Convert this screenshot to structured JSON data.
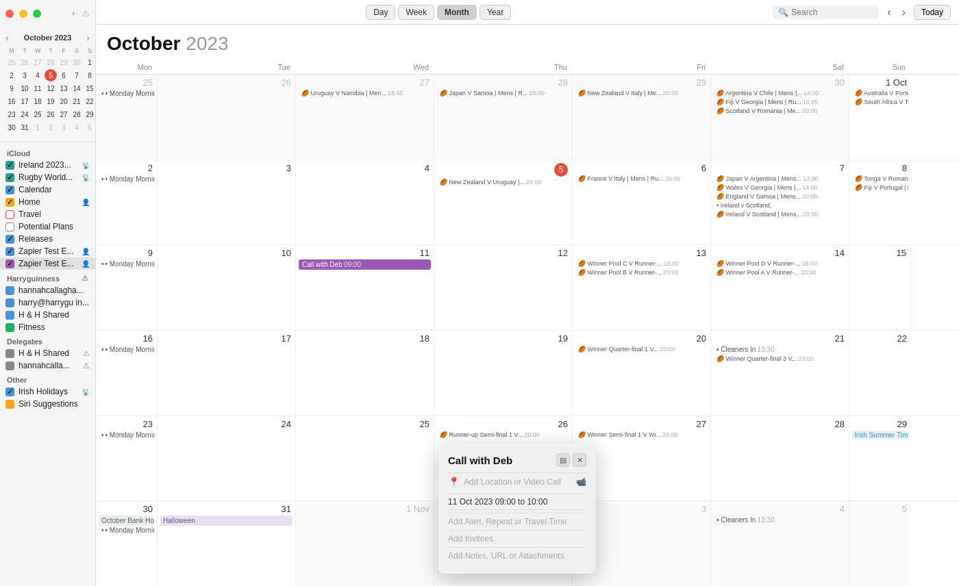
{
  "sidebar": {
    "icloud_label": "iCloud",
    "items": [
      {
        "id": "ireland",
        "label": "Ireland 2023...",
        "color": "#2a9d8f",
        "type": "checkbox",
        "checked": true,
        "badge": "📡"
      },
      {
        "id": "rugby",
        "label": "Rugby World...",
        "color": "#2a9d8f",
        "type": "checkbox",
        "checked": true,
        "badge": "📡"
      },
      {
        "id": "calendar",
        "label": "Calendar",
        "color": "#4a90d9",
        "type": "checkbox",
        "checked": true
      },
      {
        "id": "home",
        "label": "Home",
        "color": "#f5a623",
        "type": "checkbox",
        "checked": true,
        "badge": "👤"
      },
      {
        "id": "travel",
        "label": "Travel",
        "color": "#e74c3c",
        "type": "checkbox",
        "checked": false
      },
      {
        "id": "potential",
        "label": "Potential Plans",
        "color": "#888",
        "type": "checkbox",
        "checked": false
      },
      {
        "id": "releases",
        "label": "Releases",
        "color": "#4a90d9",
        "type": "checkbox",
        "checked": true
      },
      {
        "id": "zapier1",
        "label": "Zapier Test E...",
        "color": "#4a90d9",
        "type": "checkbox",
        "checked": true,
        "badge": "👤"
      },
      {
        "id": "zapier2",
        "label": "Zapier Test E...",
        "color": "#9b59b6",
        "type": "checkbox",
        "checked": true,
        "badge": "👤",
        "selected": true
      }
    ],
    "harryguinness_label": "Harryguinness",
    "delegates": [
      {
        "id": "hannah",
        "label": "hannahcallagha...",
        "color": "#4a90d9",
        "type": "dot"
      },
      {
        "id": "harry",
        "label": "harry@harrygu in...",
        "color": "#4a90d9",
        "type": "dot"
      },
      {
        "id": "hh",
        "label": "H & H Shared",
        "color": "#4a90d9",
        "type": "dot"
      },
      {
        "id": "fitness",
        "label": "Fitness",
        "color": "#27ae60",
        "type": "dot"
      }
    ],
    "delegates_label": "Delegates",
    "delegate_items": [
      {
        "id": "hh2",
        "label": "H & H Shared",
        "color": "#555",
        "badge": "⚠"
      },
      {
        "id": "hannahcalla",
        "label": "hannahcalla...",
        "color": "#555",
        "badge": "⚠"
      }
    ],
    "other_label": "Other",
    "other_items": [
      {
        "id": "irish_holidays",
        "label": "Irish Holidays",
        "color": "#4a90d9",
        "type": "checkbox",
        "checked": true,
        "badge": "📡"
      },
      {
        "id": "siri",
        "label": "Siri Suggestions",
        "color": "#f5a623",
        "type": "dot"
      }
    ],
    "mini_cal": {
      "title": "October 2023",
      "days_header": [
        "M",
        "T",
        "W",
        "T",
        "F",
        "S",
        "S"
      ],
      "weeks": [
        [
          {
            "d": "25",
            "o": true
          },
          {
            "d": "26",
            "o": true
          },
          {
            "d": "27",
            "o": true
          },
          {
            "d": "28",
            "o": true
          },
          {
            "d": "29",
            "o": true
          },
          {
            "d": "30",
            "o": true
          },
          {
            "d": "1"
          }
        ],
        [
          {
            "d": "2"
          },
          {
            "d": "3"
          },
          {
            "d": "4"
          },
          {
            "d": "5",
            "today": true
          },
          {
            "d": "6"
          },
          {
            "d": "7"
          },
          {
            "d": "8"
          }
        ],
        [
          {
            "d": "9"
          },
          {
            "d": "10"
          },
          {
            "d": "11"
          },
          {
            "d": "12"
          },
          {
            "d": "13"
          },
          {
            "d": "14"
          },
          {
            "d": "15"
          }
        ],
        [
          {
            "d": "16"
          },
          {
            "d": "17"
          },
          {
            "d": "18"
          },
          {
            "d": "19"
          },
          {
            "d": "20"
          },
          {
            "d": "21"
          },
          {
            "d": "22"
          }
        ],
        [
          {
            "d": "23"
          },
          {
            "d": "24"
          },
          {
            "d": "25"
          },
          {
            "d": "26"
          },
          {
            "d": "27"
          },
          {
            "d": "28"
          },
          {
            "d": "29"
          }
        ],
        [
          {
            "d": "30"
          },
          {
            "d": "31"
          },
          {
            "d": "1",
            "o": true
          },
          {
            "d": "2",
            "o": true
          },
          {
            "d": "3",
            "o": true
          },
          {
            "d": "4",
            "o": true
          },
          {
            "d": "5",
            "o": true
          }
        ]
      ]
    }
  },
  "toolbar": {
    "add_label": "+",
    "alert_label": "⚠",
    "views": [
      "Day",
      "Week",
      "Month",
      "Year"
    ],
    "active_view": "Month",
    "search_placeholder": "Search",
    "today_label": "Today",
    "prev_label": "‹",
    "next_label": "›"
  },
  "calendar": {
    "month": "October",
    "year": "2023",
    "day_headers": [
      "Mon",
      "Tue",
      "Wed",
      "Thu",
      "Fri",
      "Sat",
      "Sun"
    ],
    "popup": {
      "title": "Call with Deb",
      "location_placeholder": "Add Location or Video Call",
      "video_icon": "📹",
      "datetime": "11 Oct 2023  09:00 to 10:00",
      "alert_placeholder": "Add Alert, Repeat or Travel Time",
      "invitees_placeholder": "Add Invitees",
      "notes_placeholder": "Add Notes, URL or Attachments"
    }
  }
}
